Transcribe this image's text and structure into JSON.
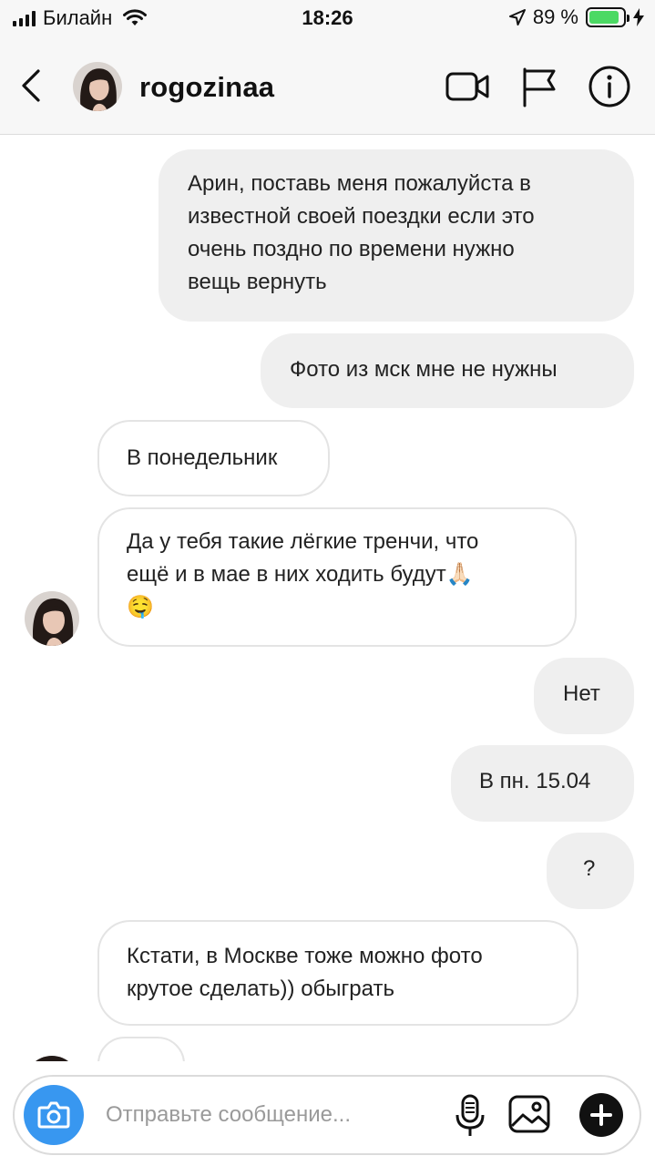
{
  "status_bar": {
    "carrier": "Билайн",
    "time": "18:26",
    "battery_percent": "89 %",
    "battery_level": 0.89
  },
  "header": {
    "username": "rogozinaa",
    "icons": [
      "back-icon",
      "video-call-icon",
      "flag-icon",
      "info-icon"
    ]
  },
  "messages": [
    {
      "direction": "outgoing",
      "lines": [
        "Арин, поставь меня пожалуйста в",
        "известной своей поездки если это",
        "очень поздно по времени нужно",
        "вещь вернуть"
      ]
    },
    {
      "direction": "outgoing",
      "lines": [
        "Фото из мск мне не нужны"
      ]
    },
    {
      "direction": "incoming",
      "lines": [
        "В понедельник"
      ]
    },
    {
      "direction": "incoming",
      "lines": [
        "Да у тебя такие лёгкие тренчи, что",
        "ещё и в мае в них ходить будут🙏🏻",
        "🤤"
      ]
    },
    {
      "direction": "outgoing",
      "lines": [
        "Нет"
      ]
    },
    {
      "direction": "outgoing",
      "lines": [
        "В пн. 15.04"
      ]
    },
    {
      "direction": "outgoing",
      "lines": [
        "?"
      ]
    },
    {
      "direction": "incoming",
      "lines": [
        "Кстати, в Москве тоже можно фото",
        "крутое сделать)) обыграть"
      ]
    }
  ],
  "composer": {
    "placeholder": "Отправьте сообщение...",
    "icons": [
      "camera-icon",
      "microphone-icon",
      "gallery-icon",
      "plus-icon"
    ]
  },
  "colors": {
    "accent": "#3897f0",
    "outgoing_bubble": "#efefef",
    "incoming_border": "#e4e4e4",
    "battery": "#4cd964"
  }
}
